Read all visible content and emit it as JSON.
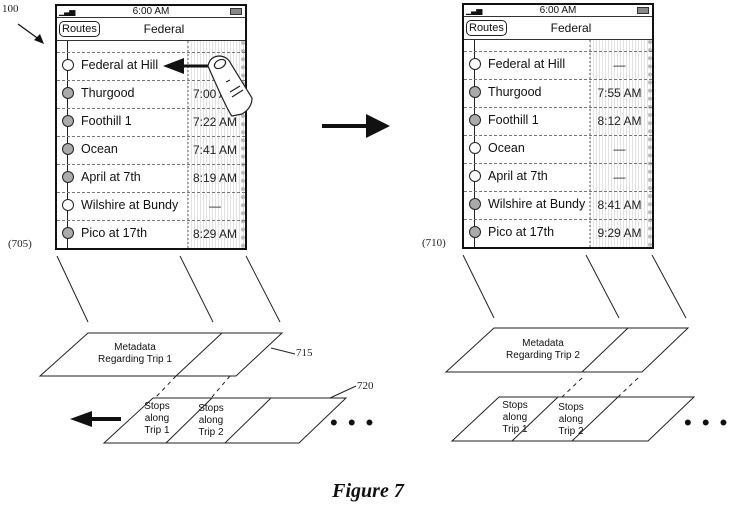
{
  "figure": {
    "caption": "Figure 7",
    "device_ref": "100"
  },
  "left_screen": {
    "ref": "(705)",
    "status_time": "6:00 AM",
    "routes_button": "Routes",
    "title": "Federal",
    "stops": [
      {
        "name": "Federal at Hill",
        "time": "",
        "filled": false
      },
      {
        "name": "Thurgood",
        "time": "7:00 AM",
        "filled": true
      },
      {
        "name": "Foothill 1",
        "time": "7:22 AM",
        "filled": true
      },
      {
        "name": "Ocean",
        "time": "7:41 AM",
        "filled": true
      },
      {
        "name": "April at 7th",
        "time": "8:19 AM",
        "filled": true
      },
      {
        "name": "Wilshire at Bundy",
        "time": "—",
        "filled": false
      },
      {
        "name": "Pico at 17th",
        "time": "8:29 AM",
        "filled": true
      }
    ]
  },
  "right_screen": {
    "ref": "(710)",
    "status_time": "6:00 AM",
    "routes_button": "Routes",
    "title": "Federal",
    "stops": [
      {
        "name": "Federal at Hill",
        "time": "—",
        "filled": false
      },
      {
        "name": "Thurgood",
        "time": "7:55 AM",
        "filled": true
      },
      {
        "name": "Foothill 1",
        "time": "8:12 AM",
        "filled": true
      },
      {
        "name": "Ocean",
        "time": "—",
        "filled": false
      },
      {
        "name": "April at 7th",
        "time": "—",
        "filled": false
      },
      {
        "name": "Wilshire at Bundy",
        "time": "8:41 AM",
        "filled": true
      },
      {
        "name": "Pico at 17th",
        "time": "9:29 AM",
        "filled": true
      }
    ]
  },
  "left_data": {
    "metadata_label_1": "Metadata",
    "metadata_label_2": "Regarding Trip 1",
    "metadata_ref": "715",
    "stops_ref": "720",
    "stops_cell_1": [
      "Stops",
      "along",
      "Trip 1"
    ],
    "stops_cell_2": [
      "Stops",
      "along",
      "Trip 2"
    ],
    "ellipsis": "• • •"
  },
  "right_data": {
    "metadata_label_1": "Metadata",
    "metadata_label_2": "Regarding Trip 2",
    "stops_cell_1": [
      "Stops",
      "along",
      "Trip 1"
    ],
    "stops_cell_2": [
      "Stops",
      "along",
      "Trip 2"
    ],
    "ellipsis": "• • •"
  }
}
